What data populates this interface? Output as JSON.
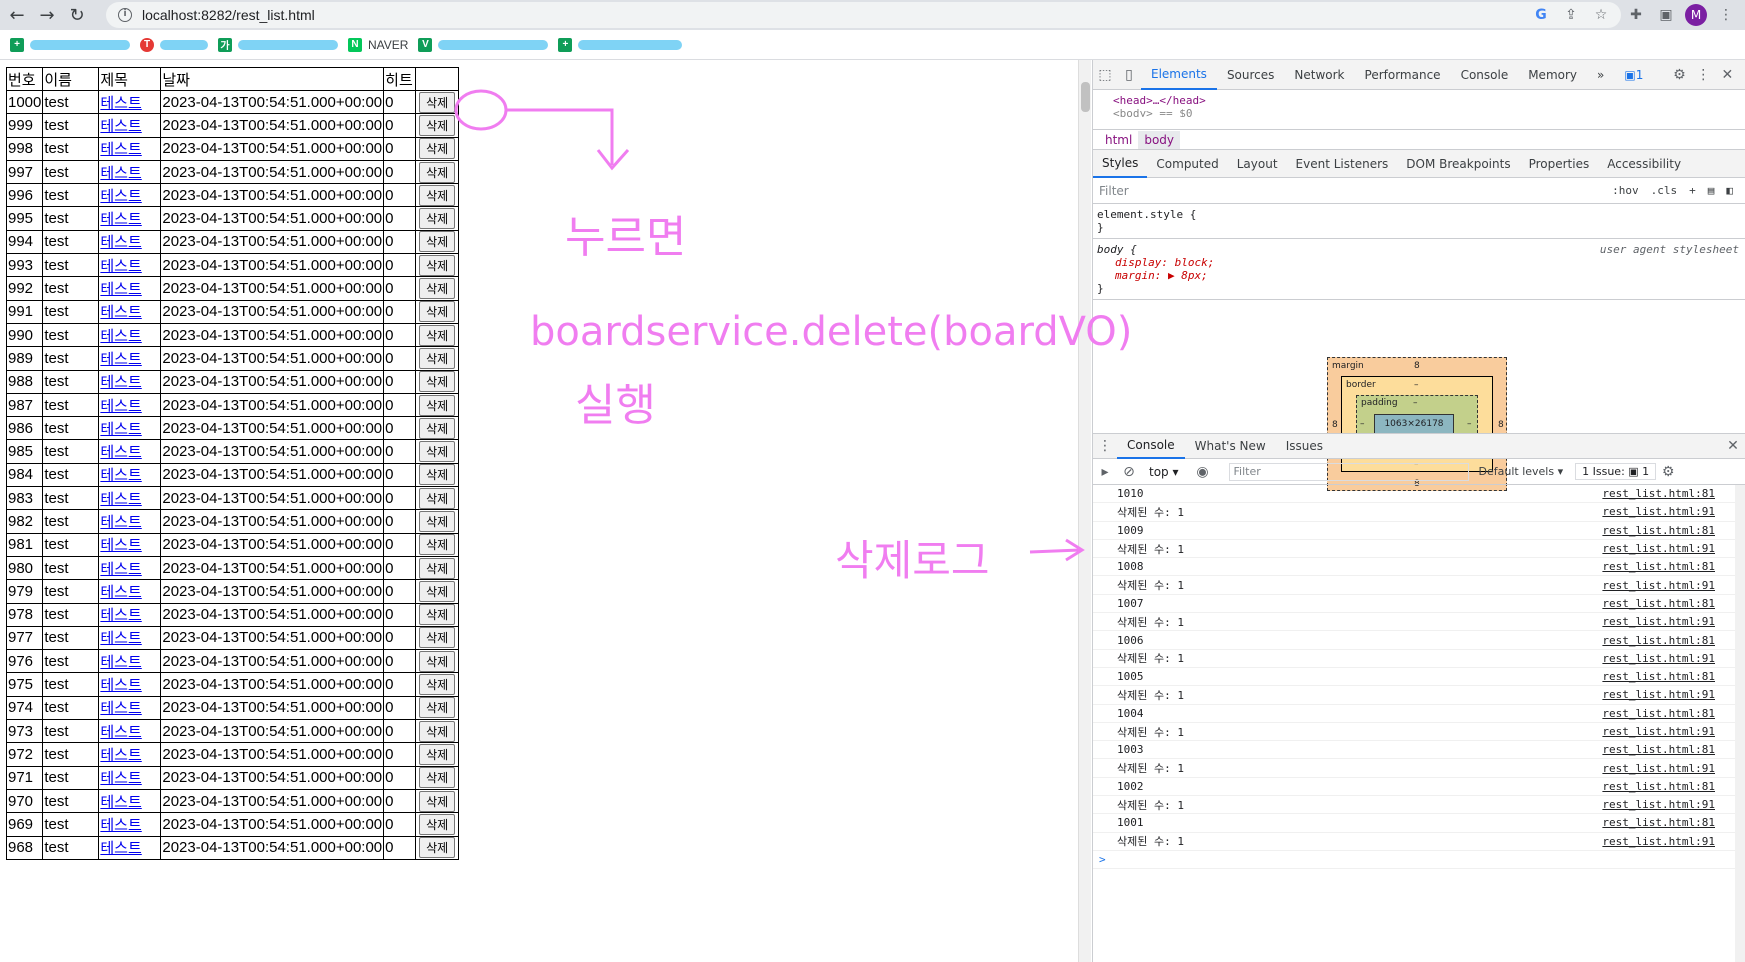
{
  "browser": {
    "url": "localhost:8282/rest_list.html",
    "avatar_letter": "M",
    "bookmark_naver": "NAVER"
  },
  "table": {
    "headers": [
      "번호",
      "이름",
      "제목",
      "날짜",
      "히트",
      ""
    ],
    "rows": [
      {
        "no": "1000",
        "name": "test",
        "title": "테스트",
        "date": "2023-04-13T00:54:51.000+00:00",
        "hit": "0",
        "btn": "삭제"
      },
      {
        "no": "999",
        "name": "test",
        "title": "테스트",
        "date": "2023-04-13T00:54:51.000+00:00",
        "hit": "0",
        "btn": "삭제"
      },
      {
        "no": "998",
        "name": "test",
        "title": "테스트",
        "date": "2023-04-13T00:54:51.000+00:00",
        "hit": "0",
        "btn": "삭제"
      },
      {
        "no": "997",
        "name": "test",
        "title": "테스트",
        "date": "2023-04-13T00:54:51.000+00:00",
        "hit": "0",
        "btn": "삭제"
      },
      {
        "no": "996",
        "name": "test",
        "title": "테스트",
        "date": "2023-04-13T00:54:51.000+00:00",
        "hit": "0",
        "btn": "삭제"
      },
      {
        "no": "995",
        "name": "test",
        "title": "테스트",
        "date": "2023-04-13T00:54:51.000+00:00",
        "hit": "0",
        "btn": "삭제"
      },
      {
        "no": "994",
        "name": "test",
        "title": "테스트",
        "date": "2023-04-13T00:54:51.000+00:00",
        "hit": "0",
        "btn": "삭제"
      },
      {
        "no": "993",
        "name": "test",
        "title": "테스트",
        "date": "2023-04-13T00:54:51.000+00:00",
        "hit": "0",
        "btn": "삭제"
      },
      {
        "no": "992",
        "name": "test",
        "title": "테스트",
        "date": "2023-04-13T00:54:51.000+00:00",
        "hit": "0",
        "btn": "삭제"
      },
      {
        "no": "991",
        "name": "test",
        "title": "테스트",
        "date": "2023-04-13T00:54:51.000+00:00",
        "hit": "0",
        "btn": "삭제"
      },
      {
        "no": "990",
        "name": "test",
        "title": "테스트",
        "date": "2023-04-13T00:54:51.000+00:00",
        "hit": "0",
        "btn": "삭제"
      },
      {
        "no": "989",
        "name": "test",
        "title": "테스트",
        "date": "2023-04-13T00:54:51.000+00:00",
        "hit": "0",
        "btn": "삭제"
      },
      {
        "no": "988",
        "name": "test",
        "title": "테스트",
        "date": "2023-04-13T00:54:51.000+00:00",
        "hit": "0",
        "btn": "삭제"
      },
      {
        "no": "987",
        "name": "test",
        "title": "테스트",
        "date": "2023-04-13T00:54:51.000+00:00",
        "hit": "0",
        "btn": "삭제"
      },
      {
        "no": "986",
        "name": "test",
        "title": "테스트",
        "date": "2023-04-13T00:54:51.000+00:00",
        "hit": "0",
        "btn": "삭제"
      },
      {
        "no": "985",
        "name": "test",
        "title": "테스트",
        "date": "2023-04-13T00:54:51.000+00:00",
        "hit": "0",
        "btn": "삭제"
      },
      {
        "no": "984",
        "name": "test",
        "title": "테스트",
        "date": "2023-04-13T00:54:51.000+00:00",
        "hit": "0",
        "btn": "삭제"
      },
      {
        "no": "983",
        "name": "test",
        "title": "테스트",
        "date": "2023-04-13T00:54:51.000+00:00",
        "hit": "0",
        "btn": "삭제"
      },
      {
        "no": "982",
        "name": "test",
        "title": "테스트",
        "date": "2023-04-13T00:54:51.000+00:00",
        "hit": "0",
        "btn": "삭제"
      },
      {
        "no": "981",
        "name": "test",
        "title": "테스트",
        "date": "2023-04-13T00:54:51.000+00:00",
        "hit": "0",
        "btn": "삭제"
      },
      {
        "no": "980",
        "name": "test",
        "title": "테스트",
        "date": "2023-04-13T00:54:51.000+00:00",
        "hit": "0",
        "btn": "삭제"
      },
      {
        "no": "979",
        "name": "test",
        "title": "테스트",
        "date": "2023-04-13T00:54:51.000+00:00",
        "hit": "0",
        "btn": "삭제"
      },
      {
        "no": "978",
        "name": "test",
        "title": "테스트",
        "date": "2023-04-13T00:54:51.000+00:00",
        "hit": "0",
        "btn": "삭제"
      },
      {
        "no": "977",
        "name": "test",
        "title": "테스트",
        "date": "2023-04-13T00:54:51.000+00:00",
        "hit": "0",
        "btn": "삭제"
      },
      {
        "no": "976",
        "name": "test",
        "title": "테스트",
        "date": "2023-04-13T00:54:51.000+00:00",
        "hit": "0",
        "btn": "삭제"
      },
      {
        "no": "975",
        "name": "test",
        "title": "테스트",
        "date": "2023-04-13T00:54:51.000+00:00",
        "hit": "0",
        "btn": "삭제"
      },
      {
        "no": "974",
        "name": "test",
        "title": "테스트",
        "date": "2023-04-13T00:54:51.000+00:00",
        "hit": "0",
        "btn": "삭제"
      },
      {
        "no": "973",
        "name": "test",
        "title": "테스트",
        "date": "2023-04-13T00:54:51.000+00:00",
        "hit": "0",
        "btn": "삭제"
      },
      {
        "no": "972",
        "name": "test",
        "title": "테스트",
        "date": "2023-04-13T00:54:51.000+00:00",
        "hit": "0",
        "btn": "삭제"
      },
      {
        "no": "971",
        "name": "test",
        "title": "테스트",
        "date": "2023-04-13T00:54:51.000+00:00",
        "hit": "0",
        "btn": "삭제"
      },
      {
        "no": "970",
        "name": "test",
        "title": "테스트",
        "date": "2023-04-13T00:54:51.000+00:00",
        "hit": "0",
        "btn": "삭제"
      },
      {
        "no": "969",
        "name": "test",
        "title": "테스트",
        "date": "2023-04-13T00:54:51.000+00:00",
        "hit": "0",
        "btn": "삭제"
      },
      {
        "no": "968",
        "name": "test",
        "title": "테스트",
        "date": "2023-04-13T00:54:51.000+00:00",
        "hit": "0",
        "btn": "삭제"
      }
    ]
  },
  "annotations": {
    "line1": "누르면",
    "line2": "boardservice.delete(boardVO)",
    "line3": "실행",
    "log_note": "삭제로그",
    "color": "#f07df0"
  },
  "devtools": {
    "tabs": [
      "Elements",
      "Sources",
      "Network",
      "Performance",
      "Console",
      "Memory"
    ],
    "active_tab": "Elements",
    "more": "»",
    "msg_badge": "1",
    "dom_head": "<head>…</head>",
    "dom_body": "<body> == $0",
    "crumbs": [
      "html",
      "body"
    ],
    "sub_tabs": [
      "Styles",
      "Computed",
      "Layout",
      "Event Listeners",
      "DOM Breakpoints",
      "Properties",
      "Accessibility"
    ],
    "filter_placeholder": "Filter",
    "hov": ":hov",
    "cls": ".cls",
    "element_style": "element.style {",
    "close_brace": "}",
    "body_selector": "body {",
    "body_source": "user agent stylesheet",
    "prop_display": "display: block;",
    "prop_margin": "margin: ▶ 8px;",
    "box": {
      "margin_label": "margin",
      "margin_value": "8",
      "border_label": "border",
      "padding_label": "padding",
      "dash": "–",
      "content": "1063×26178",
      "side_value": "8"
    },
    "console_tabs": [
      "Console",
      "What's New",
      "Issues"
    ],
    "context": "top ▾",
    "console_filter": "Filter",
    "levels": "Default levels ▾",
    "issues_badge": "1 Issue: ▣ 1",
    "logs": [
      {
        "msg": "1010",
        "src": "rest_list.html:81"
      },
      {
        "msg": "삭제된 수: 1",
        "src": "rest_list.html:91"
      },
      {
        "msg": "1009",
        "src": "rest_list.html:81"
      },
      {
        "msg": "삭제된 수: 1",
        "src": "rest_list.html:91"
      },
      {
        "msg": "1008",
        "src": "rest_list.html:81"
      },
      {
        "msg": "삭제된 수: 1",
        "src": "rest_list.html:91"
      },
      {
        "msg": "1007",
        "src": "rest_list.html:81"
      },
      {
        "msg": "삭제된 수: 1",
        "src": "rest_list.html:91"
      },
      {
        "msg": "1006",
        "src": "rest_list.html:81"
      },
      {
        "msg": "삭제된 수: 1",
        "src": "rest_list.html:91"
      },
      {
        "msg": "1005",
        "src": "rest_list.html:81"
      },
      {
        "msg": "삭제된 수: 1",
        "src": "rest_list.html:91"
      },
      {
        "msg": "1004",
        "src": "rest_list.html:81"
      },
      {
        "msg": "삭제된 수: 1",
        "src": "rest_list.html:91"
      },
      {
        "msg": "1003",
        "src": "rest_list.html:81"
      },
      {
        "msg": "삭제된 수: 1",
        "src": "rest_list.html:91"
      },
      {
        "msg": "1002",
        "src": "rest_list.html:81"
      },
      {
        "msg": "삭제된 수: 1",
        "src": "rest_list.html:91"
      },
      {
        "msg": "1001",
        "src": "rest_list.html:81"
      },
      {
        "msg": "삭제된 수: 1",
        "src": "rest_list.html:91"
      }
    ],
    "prompt": ">"
  }
}
